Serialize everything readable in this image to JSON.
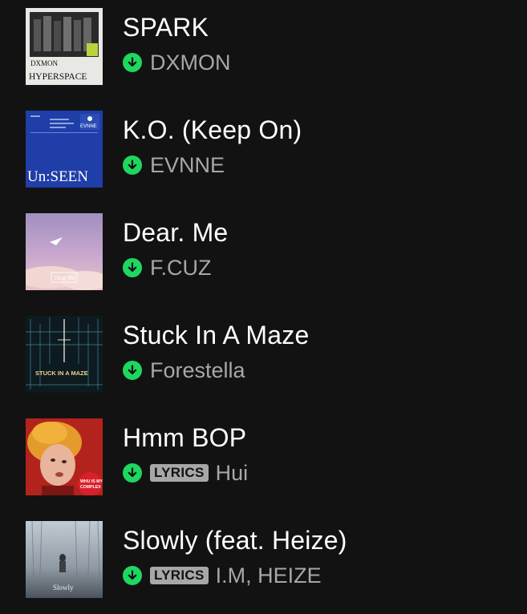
{
  "tracks": [
    {
      "title": "SPARK",
      "artist": "DXMON",
      "lyrics": false,
      "downloaded": true,
      "cover": {
        "icon": "album-cover-hyperspace",
        "text_top": "DXMON",
        "text_main": "HYPERSPACE",
        "bg": "#e8e8e4"
      }
    },
    {
      "title": "K.O. (Keep On)",
      "artist": "EVNNE",
      "lyrics": false,
      "downloaded": true,
      "cover": {
        "icon": "album-cover-unseen",
        "text_main": "Un:SEEN",
        "bg": "#1f3ea8"
      }
    },
    {
      "title": "Dear. Me",
      "artist": "F.CUZ",
      "lyrics": false,
      "downloaded": true,
      "cover": {
        "icon": "album-cover-dear-me",
        "text_main": "Dear. Me",
        "bg": "#c7a6c8"
      }
    },
    {
      "title": "Stuck In A Maze",
      "artist": "Forestella",
      "lyrics": false,
      "downloaded": true,
      "cover": {
        "icon": "album-cover-stuck-in-a-maze",
        "text_main": "STUCK IN A MAZE",
        "bg": "#0d1a1f"
      }
    },
    {
      "title": "Hmm BOP",
      "artist": "Hui",
      "lyrics": true,
      "lyrics_label": "LYRICS",
      "downloaded": true,
      "cover": {
        "icon": "album-cover-whu-is-my-complex",
        "text_main": "WHU IS MY COMPLEX",
        "bg": "#b3231d"
      }
    },
    {
      "title": "Slowly (feat. Heize)",
      "artist": "I.M, HEIZE",
      "lyrics": true,
      "lyrics_label": "LYRICS",
      "downloaded": true,
      "cover": {
        "icon": "album-cover-slowly",
        "text_main": "Slowly",
        "bg": "#9aa4ad"
      }
    }
  ],
  "colors": {
    "background": "#121212",
    "title": "#ffffff",
    "subtext": "#a7a7a7",
    "download_accent": "#1ed760"
  },
  "icons": {
    "download": "download-arrow-icon"
  }
}
